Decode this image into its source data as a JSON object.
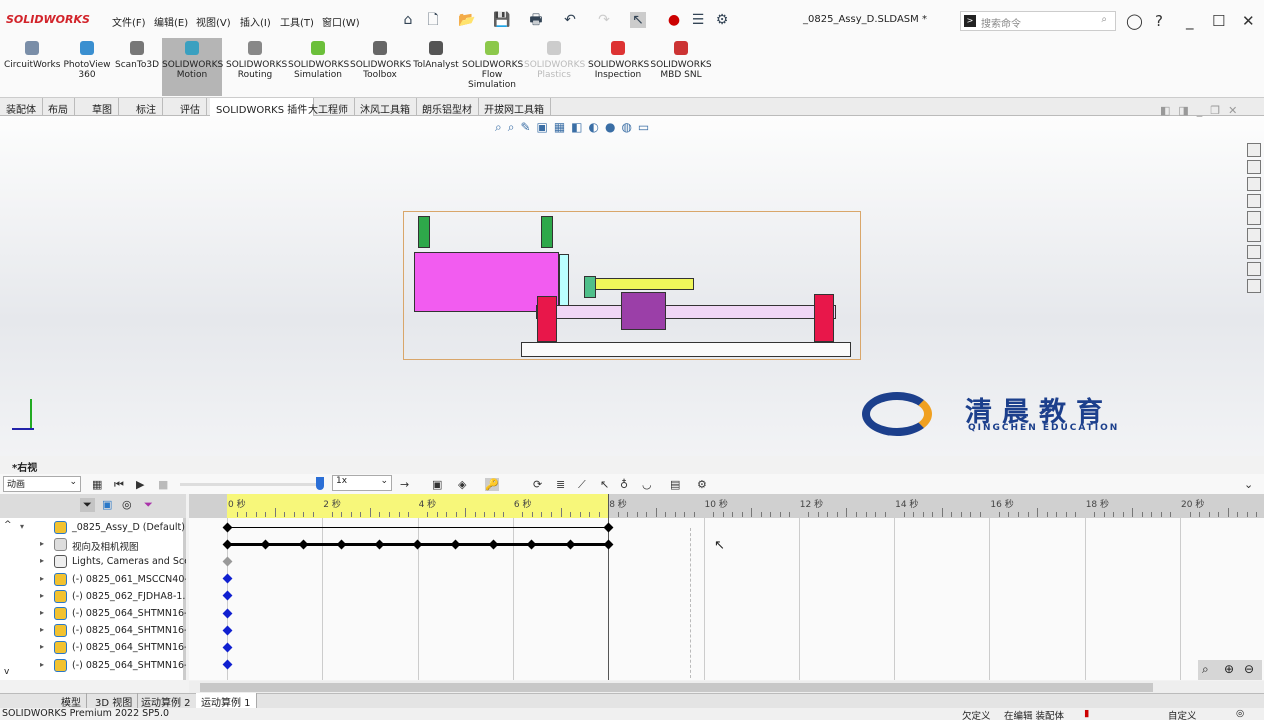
{
  "app": {
    "brand": "SOLIDWORKS",
    "doc_title": "_0825_Assy_D.SLDASM *",
    "search_placeholder": "搜索命令"
  },
  "menu": [
    "文件(F)",
    "编辑(E)",
    "视图(V)",
    "插入(I)",
    "工具(T)",
    "窗口(W)"
  ],
  "ribbon": [
    {
      "label": "CircuitWorks",
      "color": "#7a8ea8"
    },
    {
      "label": "PhotoView 360",
      "color": "#3a8fd0"
    },
    {
      "label": "ScanTo3D",
      "color": "#777"
    },
    {
      "label": "SOLIDWORKS Motion",
      "color": "#3aa0c0",
      "active": true
    },
    {
      "label": "SOLIDWORKS Routing",
      "color": "#888"
    },
    {
      "label": "SOLIDWORKS Simulation",
      "color": "#6bbf3a"
    },
    {
      "label": "SOLIDWORKS Toolbox",
      "color": "#666"
    },
    {
      "label": "TolAnalyst",
      "color": "#555"
    },
    {
      "label": "SOLIDWORKS Flow Simulation",
      "color": "#8cc84b"
    },
    {
      "label": "SOLIDWORKS Plastics",
      "color": "#ccc",
      "disabled": true
    },
    {
      "label": "SOLIDWORKS Inspection",
      "color": "#d33"
    },
    {
      "label": "SOLIDWORKS MBD SNL",
      "color": "#c33"
    }
  ],
  "tabs": [
    "装配体",
    "布局",
    "草图",
    "标注",
    "评估",
    "SOLIDWORKS 插件",
    "大工程师",
    "沐风工具箱",
    "朗乐铝型材",
    "开拔网工具箱"
  ],
  "active_tab": "SOLIDWORKS 插件",
  "watermark": {
    "cn": "清晨教育",
    "en": "QINGCHEN EDUCATION"
  },
  "motion": {
    "view_label": "*右视",
    "study_type": "动画",
    "playback_speed": "1x",
    "time_ticks": [
      "0 秒",
      "2 秒",
      "4 秒",
      "6 秒",
      "8 秒",
      "10 秒",
      "12 秒",
      "14 秒",
      "16 秒",
      "18 秒",
      "20 秒"
    ],
    "current_end_time_s": 8,
    "tree": [
      {
        "label": "_0825_Assy_D (Default) <Def",
        "keys_s": [
          0,
          8
        ],
        "key_color": "#000",
        "line": "thin"
      },
      {
        "label": "视向及相机视图",
        "keys_s": [
          0,
          0.8,
          1.6,
          2.4,
          3.2,
          4.0,
          4.8,
          5.6,
          6.4,
          7.2,
          8.0
        ],
        "key_color": "#000",
        "line": "thick"
      },
      {
        "label": "Lights, Cameras and Sce",
        "keys_s": [
          0
        ],
        "key_color": "#999"
      },
      {
        "label": "(-) 0825_061_MSCCN40-",
        "keys_s": [
          0
        ],
        "key_color": "#1020d0"
      },
      {
        "label": "(-) 0825_062_FJDHA8-1.2",
        "keys_s": [
          0
        ],
        "key_color": "#1020d0"
      },
      {
        "label": "(-) 0825_064_SHTMN16-",
        "keys_s": [
          0
        ],
        "key_color": "#1020d0"
      },
      {
        "label": "(-) 0825_064_SHTMN16-",
        "keys_s": [
          0
        ],
        "key_color": "#1020d0"
      },
      {
        "label": "(-) 0825_064_SHTMN16-",
        "keys_s": [
          0
        ],
        "key_color": "#1020d0"
      },
      {
        "label": "(-) 0825_064_SHTMN16-",
        "keys_s": [
          0
        ],
        "key_color": "#1020d0"
      }
    ],
    "bottom_tabs": [
      "模型",
      "3D 视图",
      "运动算例 2",
      "运动算例 1"
    ],
    "active_bottom_tab": "运动算例 1"
  },
  "status": {
    "version": "SOLIDWORKS Premium 2022 SP5.0",
    "state": "欠定义",
    "mode": "在编辑 装配体",
    "units": "自定义"
  }
}
